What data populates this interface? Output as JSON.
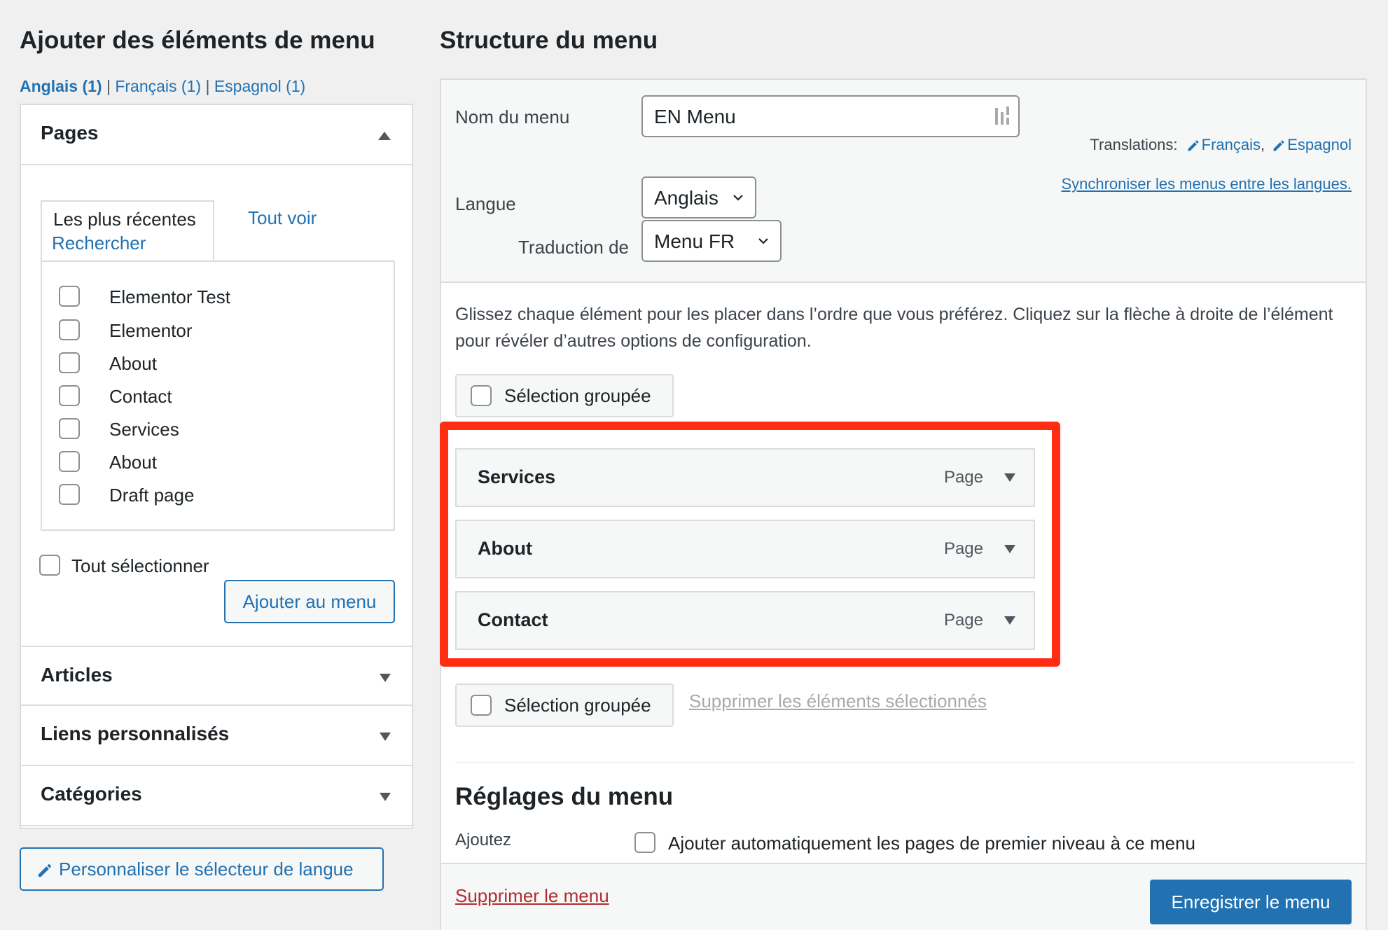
{
  "left": {
    "title": "Ajouter des éléments de menu",
    "language_filter": {
      "current": "Anglais (1)",
      "separator": "|",
      "others": [
        "Français (1)",
        "Espagnol (1)"
      ]
    },
    "pages_section": {
      "title": "Pages",
      "tabs": {
        "recent": "Les plus récentes",
        "view_all": "Tout voir",
        "search": "Rechercher"
      },
      "items": [
        "Elementor Test",
        "Elementor",
        "About",
        "Contact",
        "Services",
        "About",
        "Draft page"
      ],
      "select_all": "Tout sélectionner",
      "add_button": "Ajouter au menu"
    },
    "collapsed_sections": [
      "Articles",
      "Liens personnalisés",
      "Catégories"
    ],
    "customize_language_switcher": "Personnaliser le sélecteur de langue"
  },
  "right": {
    "title": "Structure du menu",
    "menu_name_label": "Nom du menu",
    "menu_name_value": "EN Menu",
    "translations_label": "Translations:",
    "translations": [
      "Français",
      "Espagnol"
    ],
    "sync_link": "Synchroniser les menus entre les langues.",
    "language_label": "Langue",
    "language_value": "Anglais",
    "translation_of_label": "Traduction de",
    "translation_of_value": "Menu FR",
    "instructions": "Glissez chaque élément pour les placer dans l’ordre que vous préférez. Cliquez sur la flèche à droite de l’élément pour révéler d’autres options de configuration.",
    "bulk_select": "Sélection groupée",
    "menu_items": [
      {
        "name": "Services",
        "type": "Page"
      },
      {
        "name": "About",
        "type": "Page"
      },
      {
        "name": "Contact",
        "type": "Page"
      }
    ],
    "delete_selected": "Supprimer les éléments sélectionnés",
    "settings_title": "Réglages du menu",
    "auto_add_label": "Ajoutez",
    "auto_add_option": "Ajouter automatiquement les pages de premier niveau à ce menu",
    "delete_menu": "Supprimer le menu",
    "save_button": "Enregistrer le menu"
  },
  "colors": {
    "accent": "#2271b1",
    "highlight": "#ff2d12",
    "danger": "#b32d2e",
    "background": "#f0f0f1"
  }
}
